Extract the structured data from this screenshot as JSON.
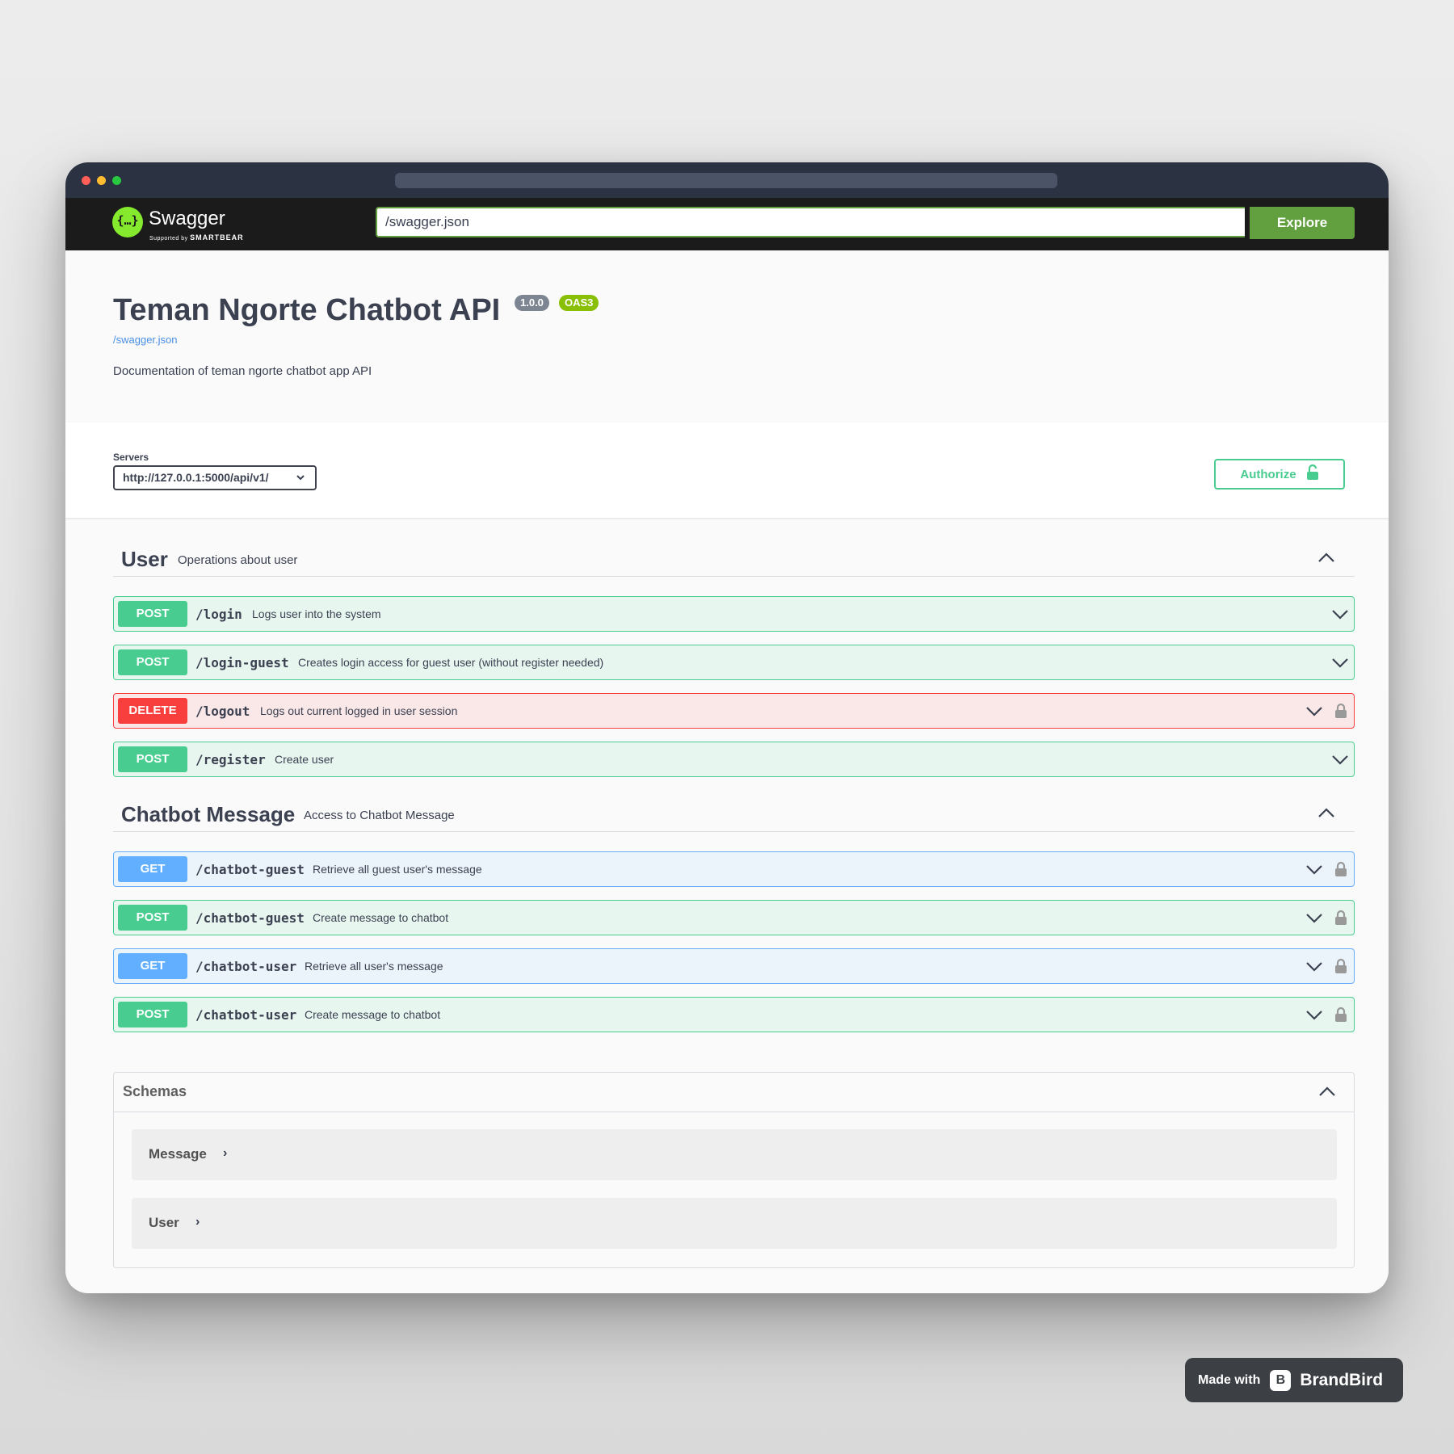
{
  "topbar": {
    "brand": "Swagger",
    "brand_sub_prefix": "Supported by",
    "brand_sub_company": "SMARTBEAR",
    "url_value": "/swagger.json",
    "explore_label": "Explore"
  },
  "info": {
    "title": "Teman Ngorte Chatbot API",
    "version": "1.0.0",
    "oas": "OAS3",
    "spec_link": "/swagger.json",
    "description": "Documentation of teman ngorte chatbot app API"
  },
  "scheme": {
    "servers_label": "Servers",
    "server_selected": "http://127.0.0.1:5000/api/v1/",
    "authorize_label": "Authorize"
  },
  "tags": [
    {
      "name": "User",
      "description": "Operations about user",
      "operations": [
        {
          "method": "POST",
          "path": "/login",
          "summary": "Logs user into the system",
          "locked": false
        },
        {
          "method": "POST",
          "path": "/login-guest",
          "summary": "Creates login access for guest user (without register needed)",
          "locked": false
        },
        {
          "method": "DELETE",
          "path": "/logout",
          "summary": "Logs out current logged in user session",
          "locked": true
        },
        {
          "method": "POST",
          "path": "/register",
          "summary": "Create user",
          "locked": false
        }
      ]
    },
    {
      "name": "Chatbot Message",
      "description": "Access to Chatbot Message",
      "operations": [
        {
          "method": "GET",
          "path": "/chatbot-guest",
          "summary": "Retrieve all guest user's message",
          "locked": true
        },
        {
          "method": "POST",
          "path": "/chatbot-guest",
          "summary": "Create message to chatbot",
          "locked": true
        },
        {
          "method": "GET",
          "path": "/chatbot-user",
          "summary": "Retrieve all user's message",
          "locked": true
        },
        {
          "method": "POST",
          "path": "/chatbot-user",
          "summary": "Create message to chatbot",
          "locked": true
        }
      ]
    }
  ],
  "schemas": {
    "title": "Schemas",
    "items": [
      "Message",
      "User"
    ]
  },
  "watermark": {
    "made_with": "Made with",
    "brand": "BrandBird"
  },
  "colors": {
    "post": "#49cc90",
    "get": "#61affe",
    "delete": "#f93e3e",
    "swagger_green": "#85ea2d",
    "explore_green": "#62a03f"
  },
  "icons": {
    "expand": "chevron-down-icon",
    "collapse": "chevron-up-icon",
    "lock": "lock-icon",
    "model_arrow": "chevron-right-icon"
  }
}
